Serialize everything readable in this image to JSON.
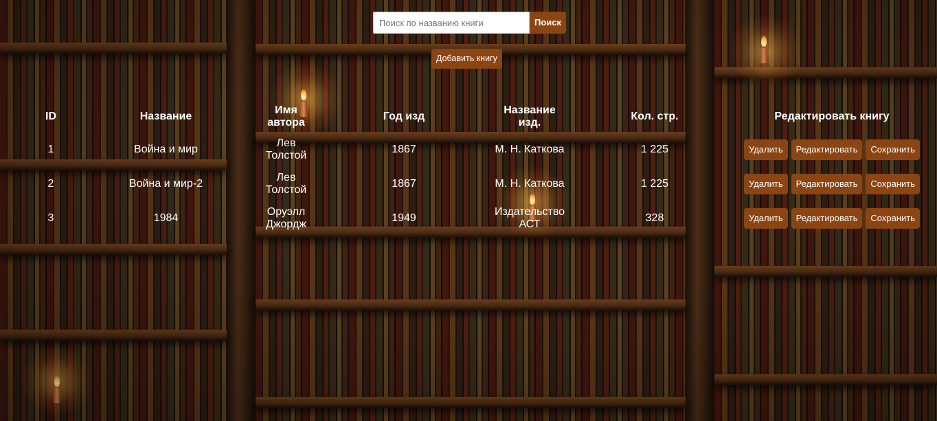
{
  "search": {
    "placeholder": "Поиск по названию книги",
    "value": "",
    "button_label": "Поиск"
  },
  "add_button_label": "Добавить книгу",
  "table": {
    "headers": {
      "id": "ID",
      "title": "Название",
      "author": "Имя автора",
      "year": "Год изд",
      "publisher": "Название изд.",
      "pages": "Кол. стр.",
      "edit": "Редактировать книгу"
    },
    "rows": [
      {
        "id": "1",
        "title": "Война и мир",
        "author": "Лев Толстой",
        "year": "1867",
        "publisher": "М. Н. Каткова",
        "pages": "1 225"
      },
      {
        "id": "2",
        "title": "Война и мир-2",
        "author": "Лев Толстой",
        "year": "1867",
        "publisher": "М. Н. Каткова",
        "pages": "1 225"
      },
      {
        "id": "3",
        "title": "1984",
        "author": "Оруэлл Джордж",
        "year": "1949",
        "publisher": "Издательство АСТ",
        "pages": "328"
      }
    ],
    "row_actions": {
      "delete_label": "Удалить",
      "edit_label": "Редактировать",
      "save_label": "Сохранить"
    }
  },
  "colors": {
    "button": "#8b4513",
    "text": "#ffffff"
  }
}
